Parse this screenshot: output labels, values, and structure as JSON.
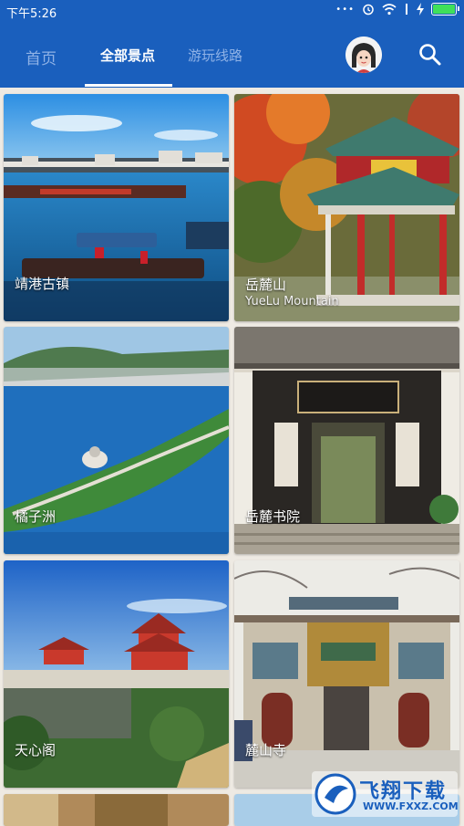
{
  "status_bar": {
    "time": "下午5:26",
    "dots": "•••"
  },
  "tabs": [
    {
      "label": "首页",
      "active": false
    },
    {
      "label": "全部景点",
      "active": true
    },
    {
      "label": "游玩线路",
      "active": false
    }
  ],
  "cards": [
    {
      "title": "靖港古镇",
      "subtitle": ""
    },
    {
      "title": "岳麓山",
      "subtitle": "YueLu Mountain"
    },
    {
      "title": "橘子洲",
      "subtitle": ""
    },
    {
      "title": "岳麓书院",
      "subtitle": ""
    },
    {
      "title": "天心阁",
      "subtitle": ""
    },
    {
      "title": "麓山寺",
      "subtitle": ""
    }
  ],
  "watermark": {
    "title": "飞翔下载",
    "url": "WWW.FXXZ.COM"
  },
  "colors": {
    "primary": "#1a5fbd",
    "tab_inactive": "#8fb2e6",
    "background": "#eeeae3"
  }
}
